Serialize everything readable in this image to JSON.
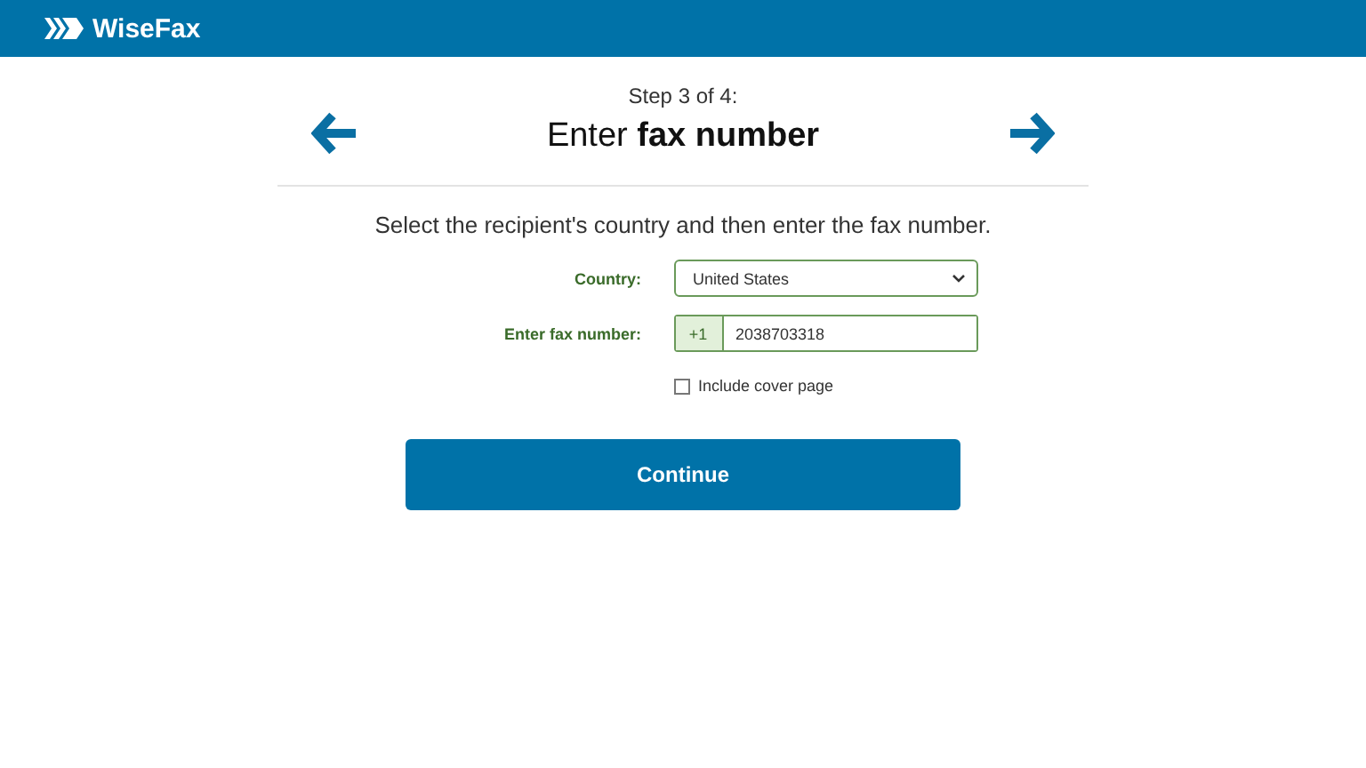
{
  "header": {
    "brand": "WiseFax"
  },
  "step": {
    "label": "Step 3 of 4:",
    "title": "Enter **fax number**"
  },
  "instruction": "Select the recipient's country and then enter the fax number.",
  "form": {
    "country_label": "Country:",
    "country": "United States",
    "fax_label": "Enter fax number:",
    "prefix": "+1",
    "fax_number": "2038703318",
    "cover_page": {
      "label": "Include cover page",
      "checked": false
    }
  },
  "button": "Continue"
}
